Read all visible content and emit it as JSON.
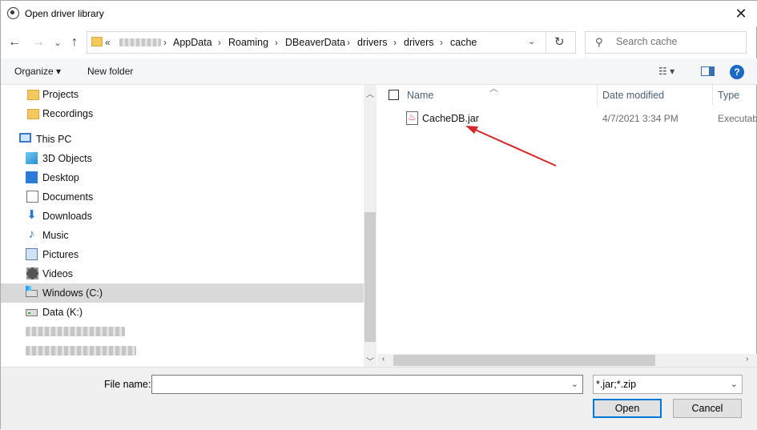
{
  "window": {
    "title": "Open driver library",
    "close_glyph": "✕"
  },
  "nav": {
    "back": "←",
    "forward": "→",
    "recent": "⌄",
    "up": "↑"
  },
  "address": {
    "prefix": "«",
    "segments": [
      "AppData",
      "Roaming",
      "DBeaverData",
      "drivers",
      "drivers",
      "cache"
    ],
    "separator": "›",
    "dropdown": "⌄",
    "refresh": "↻"
  },
  "search": {
    "placeholder": "Search cache",
    "icon": "search-icon"
  },
  "toolbar": {
    "organize": "Organize ▾",
    "new_folder": "New folder",
    "view_glyph": "☷ ▾",
    "help": "?"
  },
  "sidebar": {
    "items": [
      {
        "label": "Projects",
        "icon": "folder-icon"
      },
      {
        "label": "Recordings",
        "icon": "folder-icon"
      },
      {
        "label": "This PC",
        "icon": "computer-icon"
      },
      {
        "label": "3D Objects",
        "icon": "cube-icon"
      },
      {
        "label": "Desktop",
        "icon": "desktop-icon"
      },
      {
        "label": "Documents",
        "icon": "document-icon"
      },
      {
        "label": "Downloads",
        "icon": "download-icon"
      },
      {
        "label": "Music",
        "icon": "music-icon"
      },
      {
        "label": "Pictures",
        "icon": "pictures-icon"
      },
      {
        "label": "Videos",
        "icon": "video-icon"
      },
      {
        "label": "Windows (C:)",
        "icon": "drive-icon",
        "selected": true
      },
      {
        "label": "Data (K:)",
        "icon": "drive-icon"
      }
    ]
  },
  "columns": {
    "name": "Name",
    "date_modified": "Date modified",
    "type": "Type"
  },
  "files": [
    {
      "name": "CacheDB.jar",
      "date_modified": "4/7/2021 3:34 PM",
      "type": "Executab"
    }
  ],
  "footer": {
    "file_name_label": "File name:",
    "file_name_value": "",
    "filter": "*.jar;*.zip",
    "open": "Open",
    "cancel": "Cancel"
  },
  "colors": {
    "accent": "#0078d7",
    "annotation_arrow": "#d62828",
    "selection": "#d9d9d9"
  }
}
